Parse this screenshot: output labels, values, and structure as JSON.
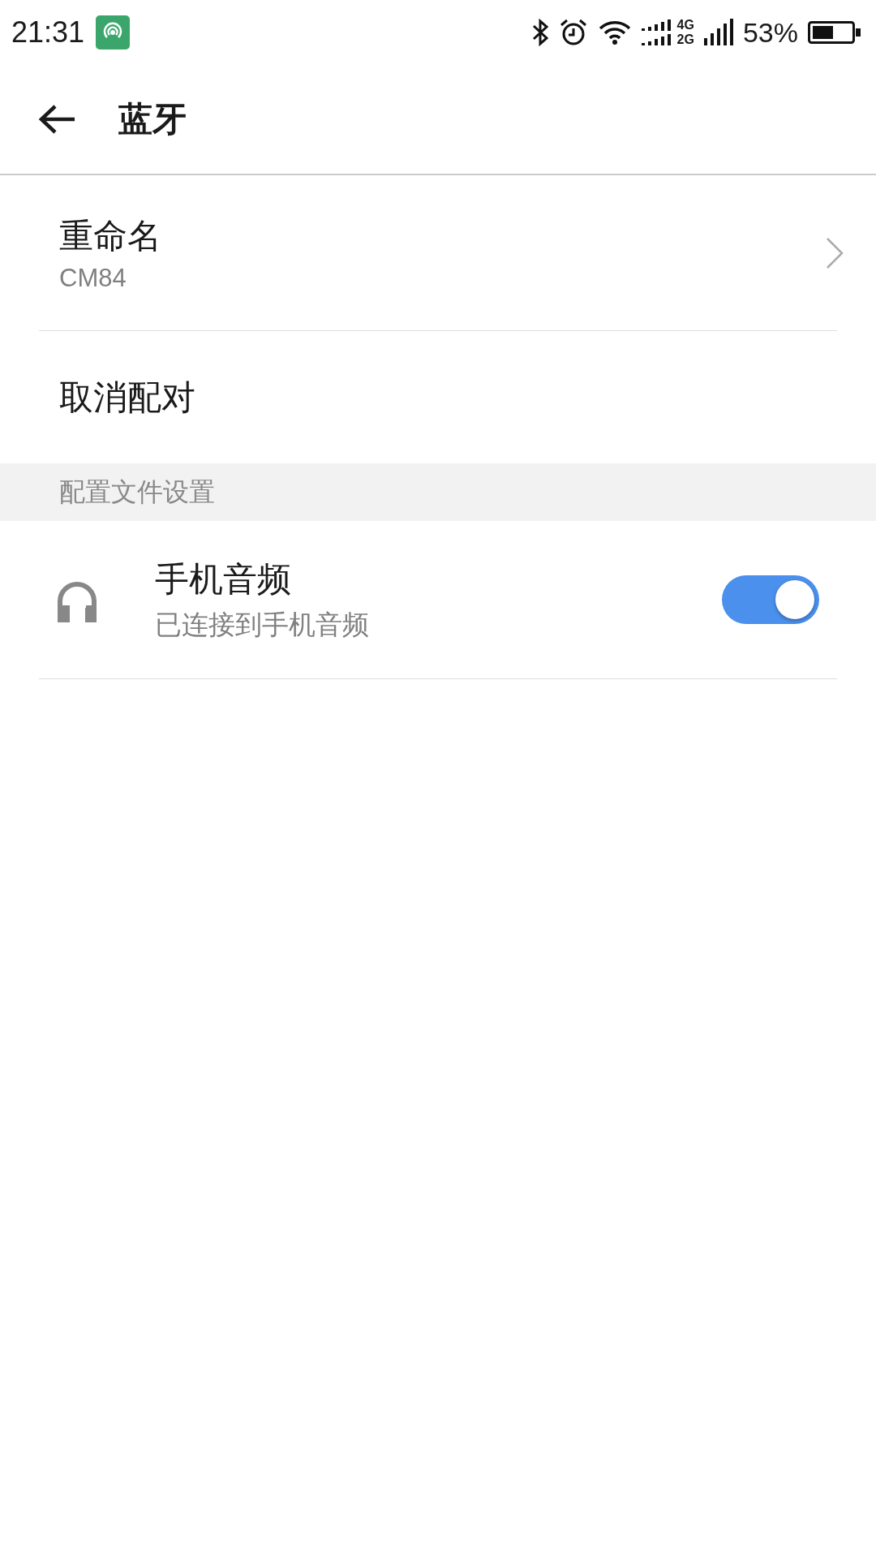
{
  "status_bar": {
    "time": "21:31",
    "network_labels": [
      "4G",
      "2G"
    ],
    "battery_percent": "53%"
  },
  "toolbar": {
    "title": "蓝牙"
  },
  "items": [
    {
      "kind": "link",
      "title": "重命名",
      "subtitle": "CM84"
    },
    {
      "kind": "action",
      "title": "取消配对"
    }
  ],
  "section_header": "配置文件设置",
  "profiles": [
    {
      "title": "手机音频",
      "subtitle": "已连接到手机音频",
      "on": true
    }
  ]
}
